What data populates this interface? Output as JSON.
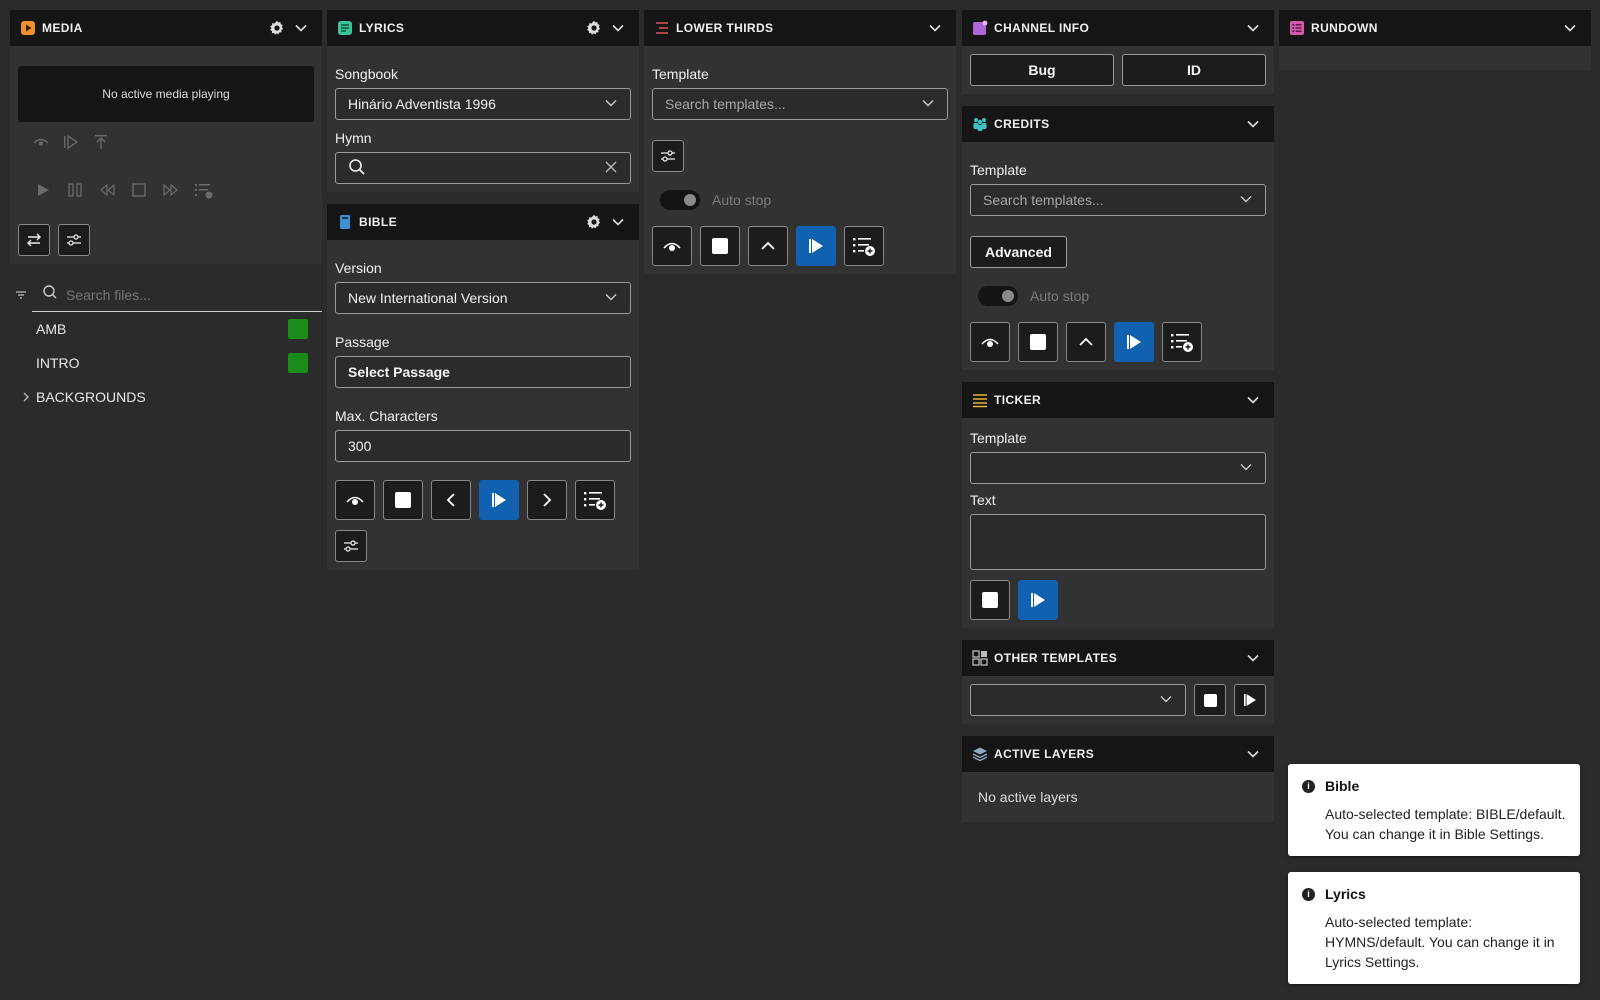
{
  "media": {
    "title": "MEDIA",
    "preview_text": "No active media playing",
    "search_placeholder": "Search files...",
    "files": [
      {
        "name": "AMB",
        "color": "#1a8c1a"
      },
      {
        "name": "INTRO",
        "color": "#1a8c1a"
      }
    ],
    "folder": "BACKGROUNDS"
  },
  "lyrics": {
    "title": "LYRICS",
    "songbook_label": "Songbook",
    "songbook_value": "Hinário Adventista 1996",
    "hymn_label": "Hymn",
    "hymn_value": ""
  },
  "bible": {
    "title": "BIBLE",
    "version_label": "Version",
    "version_value": "New International Version",
    "passage_label": "Passage",
    "passage_button": "Select Passage",
    "maxchars_label": "Max. Characters",
    "maxchars_value": "300"
  },
  "lower_thirds": {
    "title": "LOWER THIRDS",
    "template_label": "Template",
    "template_placeholder": "Search templates...",
    "autostop_label": "Auto stop"
  },
  "channel_info": {
    "title": "CHANNEL INFO",
    "bug_button": "Bug",
    "id_button": "ID"
  },
  "credits": {
    "title": "CREDITS",
    "template_label": "Template",
    "template_placeholder": "Search templates...",
    "advanced_button": "Advanced",
    "autostop_label": "Auto stop"
  },
  "ticker": {
    "title": "TICKER",
    "template_label": "Template",
    "text_label": "Text"
  },
  "other_templates": {
    "title": "OTHER TEMPLATES"
  },
  "active_layers": {
    "title": "ACTIVE LAYERS",
    "empty_text": "No active layers"
  },
  "rundown": {
    "title": "RUNDOWN"
  },
  "toasts": [
    {
      "title": "Bible",
      "message": "Auto-selected template: BIBLE/default. You can change it in Bible Settings."
    },
    {
      "title": "Lyrics",
      "message": "Auto-selected template: HYMNS/default. You can change it in Lyrics Settings."
    }
  ],
  "colors": {
    "accent": "#1061b0",
    "media_icon": "#f0902a",
    "lyrics_icon": "#3fc19a",
    "bible_icon": "#3f8fd6",
    "lower_thirds_icon": "#e0505a",
    "channel_icon": "#b066d8",
    "credits_icon": "#3fc1c9",
    "ticker_icon": "#e8b43a",
    "rundown_icon": "#d45aa8",
    "layers_icon": "#8fa9c8"
  }
}
